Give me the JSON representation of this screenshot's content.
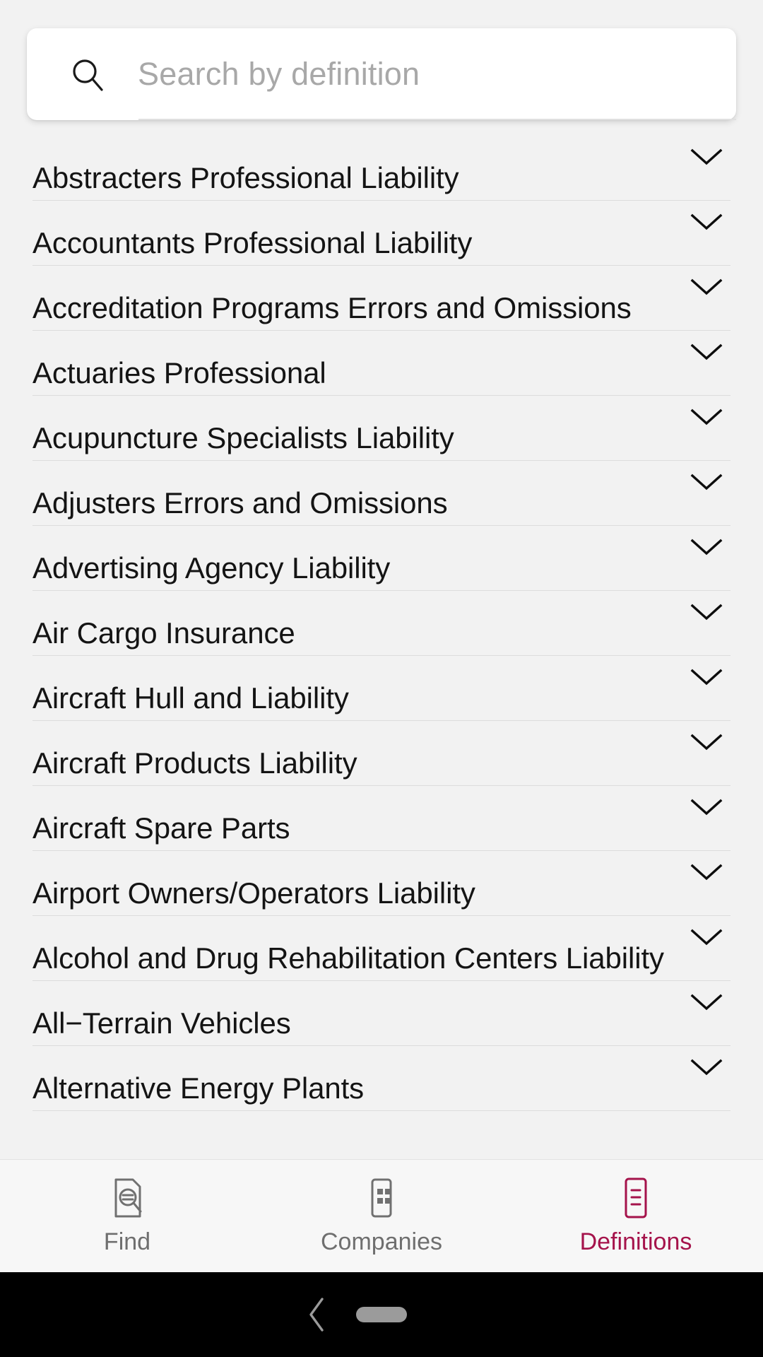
{
  "colors": {
    "background": "#f2f2f2",
    "accent": "#a5134b",
    "text": "#141414",
    "muted": "#6f6f6f",
    "placeholder": "#a8a8a8",
    "divider": "#dcdcdc",
    "card": "#ffffff",
    "tabbar": "#f7f7f7",
    "sysnav": "#000000"
  },
  "search": {
    "icon": "search-icon",
    "placeholder": "Search by definition",
    "value": ""
  },
  "list": {
    "items": [
      {
        "label": "Abstracters Professional Liability",
        "chevron": "chevron-down-icon"
      },
      {
        "label": "Accountants Professional Liability",
        "chevron": "chevron-down-icon"
      },
      {
        "label": "Accreditation Programs Errors and Omissions",
        "chevron": "chevron-down-icon"
      },
      {
        "label": "Actuaries Professional",
        "chevron": "chevron-down-icon"
      },
      {
        "label": "Acupuncture Specialists Liability",
        "chevron": "chevron-down-icon"
      },
      {
        "label": "Adjusters Errors and Omissions",
        "chevron": "chevron-down-icon"
      },
      {
        "label": "Advertising Agency Liability",
        "chevron": "chevron-down-icon"
      },
      {
        "label": "Air Cargo Insurance",
        "chevron": "chevron-down-icon"
      },
      {
        "label": "Aircraft Hull and Liability",
        "chevron": "chevron-down-icon"
      },
      {
        "label": "Aircraft Products Liability",
        "chevron": "chevron-down-icon"
      },
      {
        "label": "Aircraft Spare Parts",
        "chevron": "chevron-down-icon"
      },
      {
        "label": "Airport Owners/Operators Liability",
        "chevron": "chevron-down-icon"
      },
      {
        "label": "Alcohol and Drug Rehabilitation Centers Liability",
        "chevron": "chevron-down-icon"
      },
      {
        "label": "All−Terrain Vehicles",
        "chevron": "chevron-down-icon"
      },
      {
        "label": "Alternative Energy Plants",
        "chevron": "chevron-down-icon"
      }
    ]
  },
  "tabbar": {
    "tabs": [
      {
        "label": "Find",
        "icon": "document-search-icon",
        "active": false
      },
      {
        "label": "Companies",
        "icon": "building-grid-icon",
        "active": false
      },
      {
        "label": "Definitions",
        "icon": "document-lines-icon",
        "active": true
      }
    ]
  },
  "sysnav": {
    "back_icon": "back-chevron-icon",
    "home_indicator": "home-pill-indicator"
  }
}
